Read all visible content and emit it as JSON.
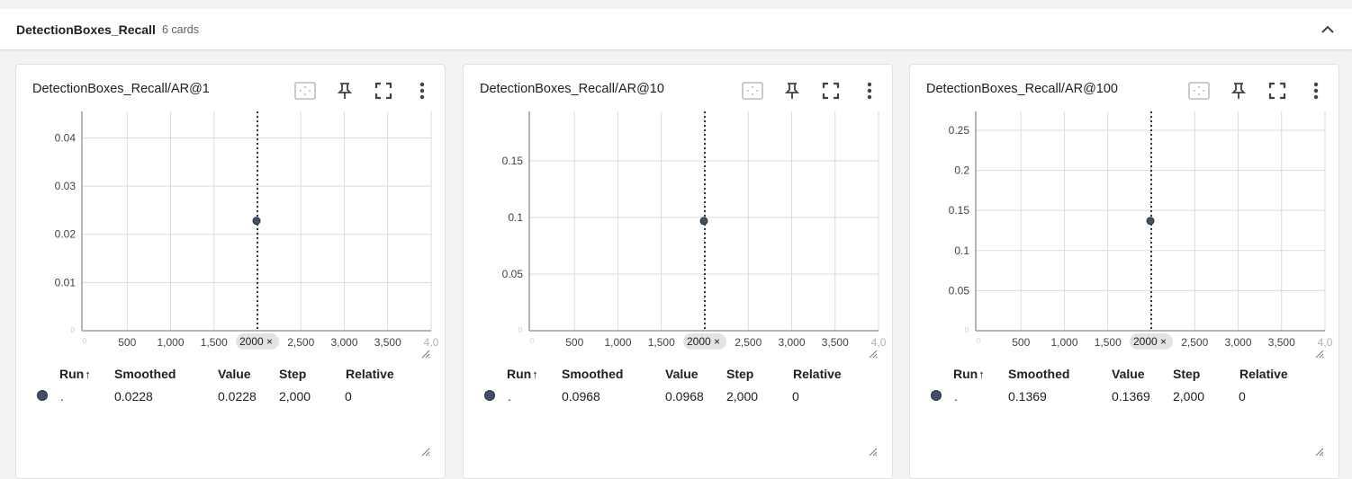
{
  "group": {
    "title": "DetectionBoxes_Recall",
    "count": "6 cards"
  },
  "table_headers": {
    "run": "Run",
    "smoothed": "Smoothed",
    "value": "Value",
    "step": "Step",
    "relative": "Relative"
  },
  "icons": {
    "collapse": "chevron-up-icon",
    "fit_domain": "fit-domain-icon",
    "pin": "pin-icon",
    "fullscreen": "fullscreen-icon",
    "menu": "more-vert-icon",
    "sort": "arrow-up-icon"
  },
  "colors": {
    "series": "#425066",
    "grid": "#dadada",
    "chip": "#e3e3e3"
  },
  "cards": [
    {
      "title": "DetectionBoxes_Recall/AR@1",
      "chip": "2000 ×",
      "row": {
        "run": ".",
        "smoothed": "0.0228",
        "value": "0.0228",
        "step": "2,000",
        "relative": "0"
      },
      "chart_data": {
        "type": "scatter",
        "x": [
          2000
        ],
        "y": [
          0.0228
        ],
        "xticks": [
          "500",
          "1,000",
          "1,500",
          "2,500",
          "3,000",
          "3,500",
          "4,0"
        ],
        "yticks": [
          "0.01",
          "0.02",
          "0.03",
          "0.04"
        ],
        "ylim": [
          0,
          0.0455
        ],
        "xlim": [
          0,
          4000
        ],
        "cursor_step": 2000
      }
    },
    {
      "title": "DetectionBoxes_Recall/AR@10",
      "chip": "2000 ×",
      "row": {
        "run": ".",
        "smoothed": "0.0968",
        "value": "0.0968",
        "step": "2,000",
        "relative": "0"
      },
      "chart_data": {
        "type": "scatter",
        "x": [
          2000
        ],
        "y": [
          0.0968
        ],
        "xticks": [
          "500",
          "1,000",
          "1,500",
          "2,500",
          "3,000",
          "3,500",
          "4,0"
        ],
        "yticks": [
          "0.05",
          "0.1",
          "0.15"
        ],
        "ylim": [
          0,
          0.1935
        ],
        "xlim": [
          0,
          4000
        ],
        "cursor_step": 2000
      }
    },
    {
      "title": "DetectionBoxes_Recall/AR@100",
      "chip": "2000 ×",
      "row": {
        "run": ".",
        "smoothed": "0.1369",
        "value": "0.1369",
        "step": "2,000",
        "relative": "0"
      },
      "chart_data": {
        "type": "scatter",
        "x": [
          2000
        ],
        "y": [
          0.1369
        ],
        "xticks": [
          "500",
          "1,000",
          "1,500",
          "2,500",
          "3,000",
          "3,500",
          "4,0"
        ],
        "yticks": [
          "0.05",
          "0.1",
          "0.15",
          "0.2",
          "0.25"
        ],
        "ylim": [
          0,
          0.2735
        ],
        "xlim": [
          0,
          4000
        ],
        "cursor_step": 2000
      }
    }
  ]
}
